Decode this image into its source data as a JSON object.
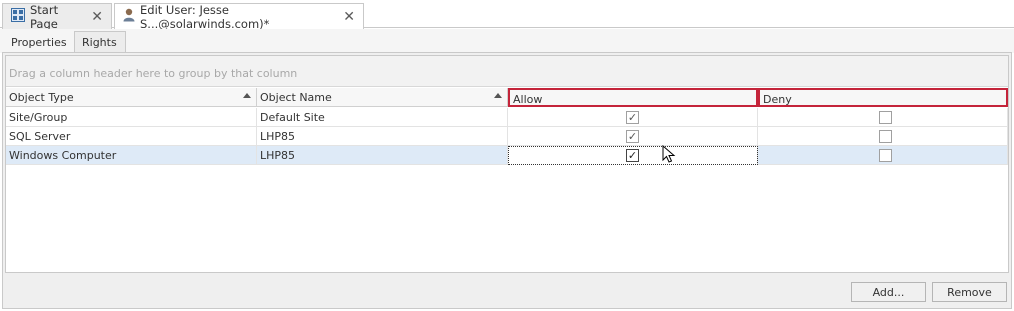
{
  "document_tabs": [
    {
      "label": "Start Page",
      "icon": "grid-icon"
    },
    {
      "label": "Edit User: Jesse S...@solarwinds.com)*",
      "icon": "user-icon"
    }
  ],
  "sub_tabs": [
    {
      "label": "Properties"
    },
    {
      "label": "Rights"
    }
  ],
  "grid": {
    "group_panel_hint": "Drag a column header here to group by that column",
    "columns": [
      "Object Type",
      "Object Name",
      "Allow",
      "Deny"
    ],
    "rows": [
      {
        "object_type": "Site/Group",
        "object_name": "Default Site",
        "allow": true,
        "deny": false
      },
      {
        "object_type": "SQL Server",
        "object_name": "LHP85",
        "allow": true,
        "deny": false
      },
      {
        "object_type": "Windows Computer",
        "object_name": "LHP85",
        "allow": true,
        "deny": false
      }
    ]
  },
  "buttons": {
    "add": "Add...",
    "remove": "Remove"
  },
  "colors": {
    "highlight": "#c4243a",
    "selected_row": "#deeaf7"
  }
}
